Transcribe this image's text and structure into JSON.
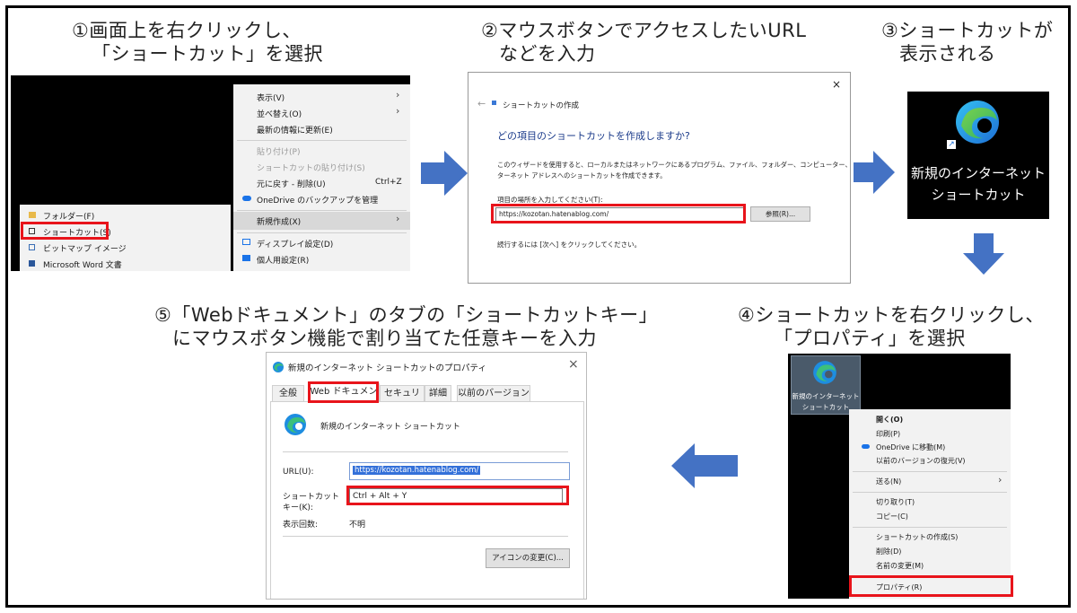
{
  "steps": {
    "s1": {
      "line1": "①画面上を右クリックし、",
      "line2": "「ショートカット」を選択"
    },
    "s2": {
      "line1": "②マウスボタンでアクセスしたいURL",
      "line2": "などを入力"
    },
    "s3": {
      "line1": "③ショートカットが",
      "line2": "表示される"
    },
    "s4": {
      "line1": "④ショートカットを右クリックし、",
      "line2": "「プロパティ」を選択"
    },
    "s5": {
      "line1": "⑤「Webドキュメント」のタブの「ショートカットキー」",
      "line2": "にマウスボタン機能で割り当てた任意キーを入力"
    }
  },
  "menu1": {
    "items": [
      "表示(V)",
      "並べ替え(O)",
      "最新の情報に更新(E)",
      "貼り付け(P)",
      "ショートカットの貼り付け(S)",
      "元に戻す - 削除(U)",
      "OneDrive のバックアップを管理",
      "新規作成(X)",
      "ディスプレイ設定(D)",
      "個人用設定(R)"
    ],
    "undo_shortcut": "Ctrl+Z",
    "submenu": [
      "フォルダー(F)",
      "ショートカット(S)",
      "ビットマップ イメージ",
      "Microsoft Word 文書"
    ]
  },
  "wizard": {
    "close": "×",
    "back": "←",
    "title": "ショートカットの作成",
    "heading": "どの項目のショートカットを作成しますか?",
    "desc1": "このウィザードを使用すると、ローカルまたはネットワークにあるプログラム、ファイル、フォルダー、コンピューター、またはイン",
    "desc2": "ターネット アドレスへのショートカットを作成できます。",
    "field_label": "項目の場所を入力してください(T):",
    "url": "https://kozotan.hatenablog.com/",
    "browse": "参照(R)...",
    "next_hint": "続行するには [次へ] をクリックしてください。"
  },
  "shortcut_icon": {
    "line1": "新規のインターネット",
    "line2": "ショートカット"
  },
  "desktop_icon": {
    "line1": "新規のインターネット",
    "line2": "ショートカット"
  },
  "menu4": {
    "items": [
      "開く(O)",
      "印刷(P)",
      "OneDrive に移動(M)",
      "以前のバージョンの復元(V)",
      "送る(N)",
      "切り取り(T)",
      "コピー(C)",
      "ショートカットの作成(S)",
      "削除(D)",
      "名前の変更(M)",
      "プロパティ(R)"
    ]
  },
  "props": {
    "title": "新規のインターネット ショートカットのプロパティ",
    "close": "×",
    "tabs": [
      "全般",
      "Web ドキュメント",
      "セキュリティ",
      "詳細",
      "以前のバージョン"
    ],
    "name": "新規のインターネット ショートカット",
    "url_label": "URL(U):",
    "url_value": "https://kozotan.hatenablog.com/",
    "key_label1": "ショートカット",
    "key_label2": "キー(K):",
    "key_value": "Ctrl + Alt + Y",
    "visits_label": "表示回数:",
    "visits_value": "不明",
    "change_icon": "アイコンの変更(C)..."
  },
  "colors": {
    "highlight": "#e8141b",
    "arrow": "#4472c4",
    "link_blue": "#1a56b8"
  }
}
